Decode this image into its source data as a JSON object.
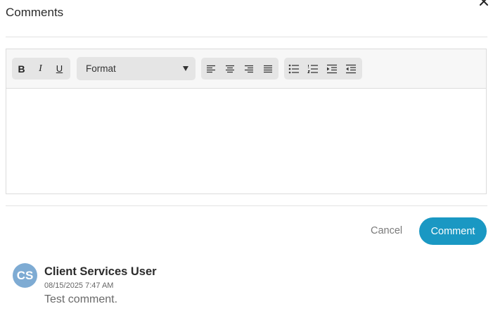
{
  "dialog": {
    "title": "Comments",
    "close_icon": "close-icon"
  },
  "toolbar": {
    "text_style": [
      {
        "name": "bold",
        "icon": "bold-icon",
        "glyph": "B"
      },
      {
        "name": "italic",
        "icon": "italic-icon",
        "glyph": "I"
      },
      {
        "name": "underline",
        "icon": "underline-icon",
        "glyph": "U"
      }
    ],
    "format_select": {
      "selected": "Format"
    },
    "alignment": [
      "align-left-icon",
      "align-center-icon",
      "align-right-icon",
      "align-justify-icon"
    ],
    "lists": [
      "bulleted-list-icon",
      "numbered-list-icon",
      "indent-icon",
      "outdent-icon"
    ]
  },
  "editor": {
    "content": ""
  },
  "actions": {
    "cancel_label": "Cancel",
    "comment_label": "Comment"
  },
  "comments": [
    {
      "initials": "CS",
      "author": "Client Services User",
      "timestamp": "08/15/2025 7:47 AM",
      "text": "Test comment."
    }
  ],
  "colors": {
    "accent": "#1a98c3",
    "avatar": "#7eabd3",
    "toolbar_bg": "#f7f7f7",
    "button_group_bg": "#e5e5e5"
  }
}
